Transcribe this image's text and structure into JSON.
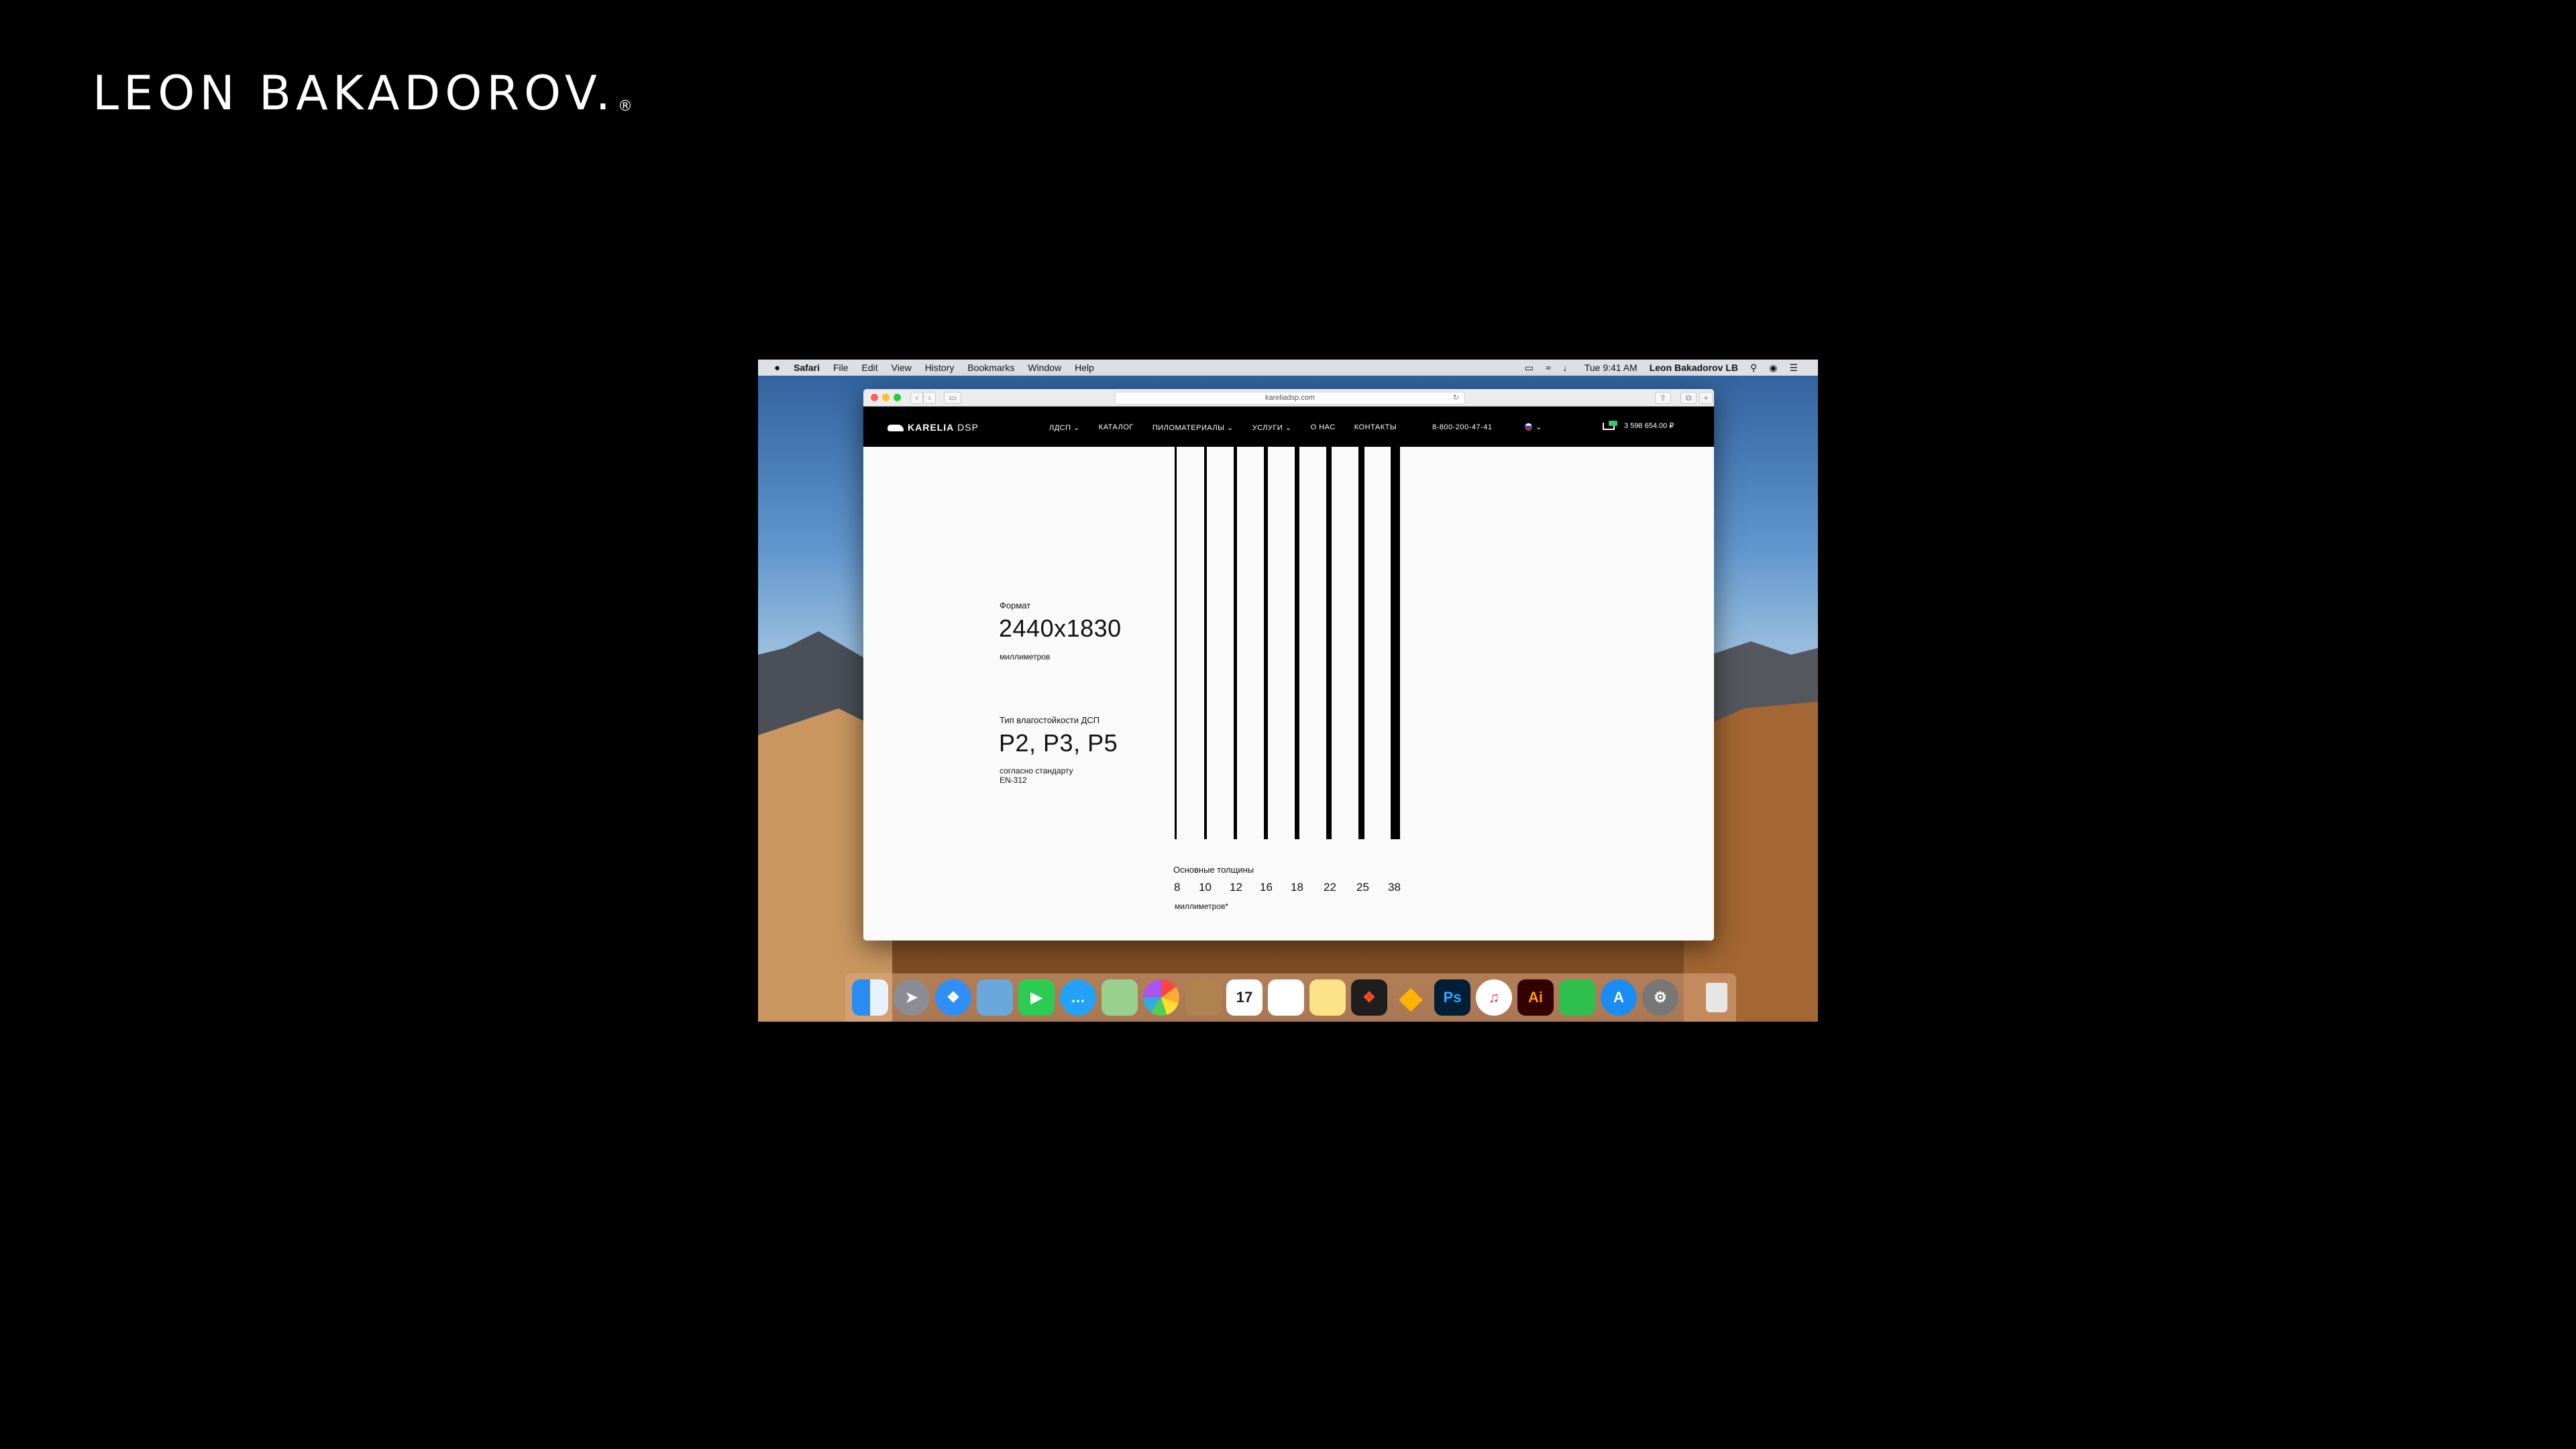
{
  "brand": {
    "name": "LEON BAKADOROV.",
    "mark": "®"
  },
  "menubar": {
    "apple": "",
    "app": "Safari",
    "items": [
      "File",
      "Edit",
      "View",
      "History",
      "Bookmarks",
      "Window",
      "Help"
    ],
    "clock": "Tue 9:41 AM",
    "user": "Leon Bakadorov LB"
  },
  "browser": {
    "url": "kareliadsp.com"
  },
  "site": {
    "logo_bold": "KARELIA",
    "logo_light": "DSP",
    "nav": [
      "ЛДСП ⌄",
      "КАТАЛОГ",
      "ПИЛОМАТЕРИАЛЫ ⌄",
      "УСЛУГИ ⌄",
      "О НАС",
      "КОНТАКТЫ"
    ],
    "phone": "8-800-200-47-41",
    "lang_caret": "⌄",
    "cart_total": "3 598 654.00 ₽"
  },
  "content": {
    "format_label": "Формат",
    "format_value": "2440x1830",
    "format_unit": "миллиметров",
    "moisture_label": "Тип влагостойкости ДСП",
    "moisture_value": "P2, P3, P5",
    "moisture_note_1": "согласно стандарту",
    "moisture_note_2": "EN-312",
    "thickness_label": "Основные толщины",
    "thicknesses": [
      "8",
      "10",
      "12",
      "16",
      "18",
      "22",
      "25",
      "38"
    ],
    "thickness_unit": "миллиметров*"
  },
  "dock": {
    "icons": [
      "finder-icon",
      "launchpad-icon",
      "safari-icon",
      "preview-icon",
      "facetime-icon",
      "messages-icon",
      "maps-icon",
      "photos-icon",
      "contacts-icon",
      "calendar-icon",
      "reminders-icon",
      "notes-icon",
      "figma-icon",
      "sketch-icon",
      "photoshop-icon",
      "music-icon",
      "illustrator-icon",
      "numbers-icon",
      "appstore-icon",
      "system-preferences-icon",
      "trash-icon"
    ],
    "calendar_day": "17",
    "ps_label": "Ps",
    "ai_label": "Ai"
  }
}
